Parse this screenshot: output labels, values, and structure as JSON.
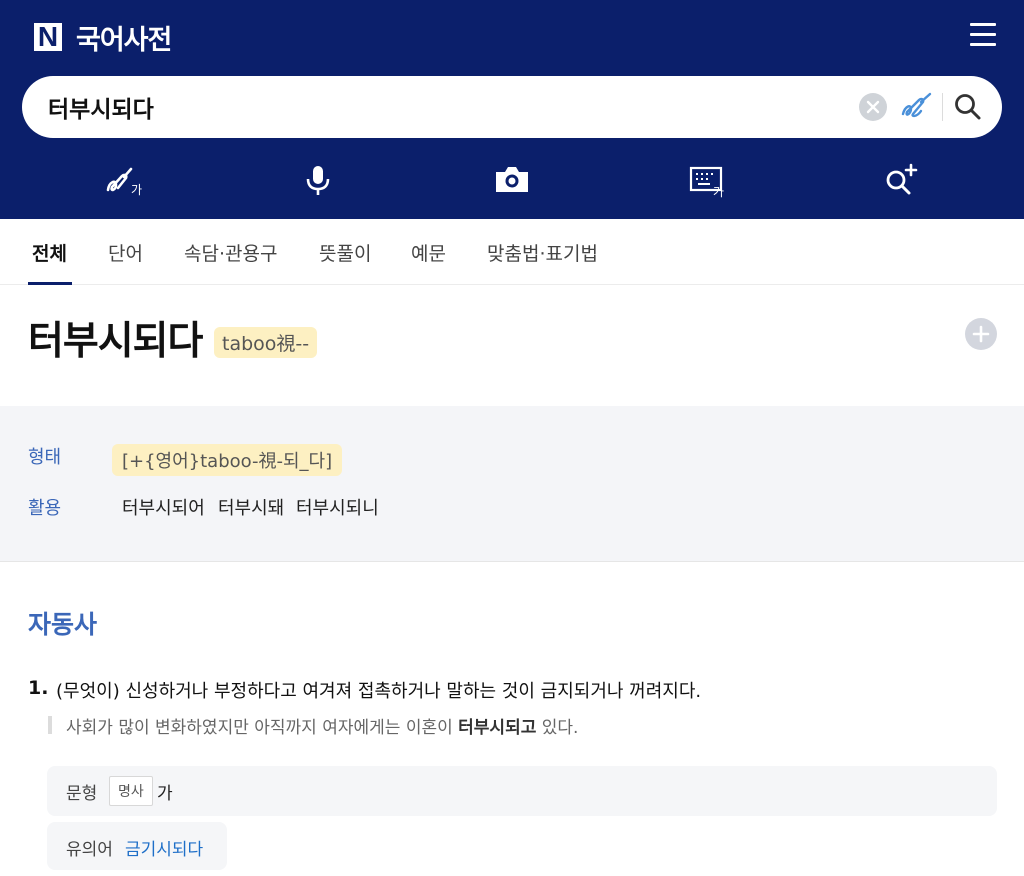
{
  "header": {
    "logo_letter": "N",
    "title": "국어사전"
  },
  "search": {
    "value": "터부시되다",
    "placeholder": ""
  },
  "tools": [
    {
      "name": "handwriting",
      "icon": "handwriting-ga-icon"
    },
    {
      "name": "voice",
      "icon": "microphone-icon"
    },
    {
      "name": "camera",
      "icon": "camera-icon"
    },
    {
      "name": "keyboard",
      "icon": "keyboard-ga-icon"
    },
    {
      "name": "detail-search",
      "icon": "search-plus-icon"
    }
  ],
  "tabs": [
    {
      "label": "전체",
      "active": true
    },
    {
      "label": "단어",
      "active": false
    },
    {
      "label": "속담·관용구",
      "active": false
    },
    {
      "label": "뜻풀이",
      "active": false
    },
    {
      "label": "예문",
      "active": false
    },
    {
      "label": "맞춤법·표기법",
      "active": false
    }
  ],
  "entry": {
    "word": "터부시되다",
    "origin": "taboo視--"
  },
  "info": {
    "form_label": "형태",
    "form_value": "[+{영어}taboo-視-되_다]",
    "conj_label": "활용",
    "conjugations": [
      "터부시되어",
      "터부시돼",
      "터부시되니"
    ]
  },
  "sense": {
    "pos": "자동사",
    "number": "1.",
    "definition": "(무엇이) 신성하거나 부정하다고 여겨져 접촉하거나 말하는 것이 금지되거나 꺼려지다.",
    "example_before": "사회가 많이 변화하였지만 아직까지 여자에게는 이혼이 ",
    "example_bold": "터부시되고",
    "example_after": " 있다.",
    "pattern_label": "문형",
    "pattern_tag": "명사",
    "pattern_value": "가",
    "synonym_label": "유의어",
    "synonym_value": "금기시되다"
  },
  "colors": {
    "header_bg": "#0b1f6b",
    "accent_blue": "#3b67b8",
    "link_blue": "#1e6fc8",
    "highlight": "#fdf0c2"
  }
}
